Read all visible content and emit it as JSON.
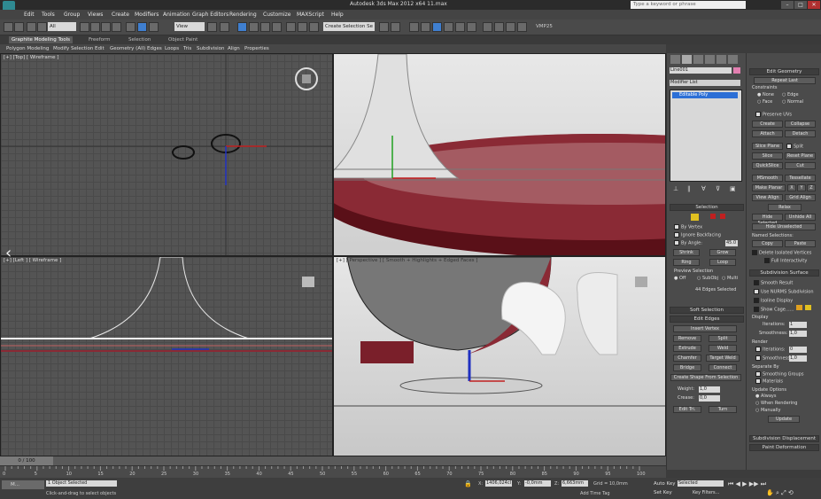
{
  "titlebar": {
    "title": "Autodesk 3ds Max  2012 x64      11.max",
    "search_placeholder": "Type a keyword or phrase",
    "minimize": "–",
    "maximize": "□",
    "close": "✕"
  },
  "menu": [
    "Edit",
    "Tools",
    "Group",
    "Views",
    "Create",
    "Modifiers",
    "Animation",
    "Graph Editors",
    "Rendering",
    "Customize",
    "MAXScript",
    "Help"
  ],
  "toolbar": {
    "selection_filter": "All",
    "ref_coord": "View",
    "named_selection": "Create Selection Se",
    "vmp_label": "VMP25"
  },
  "ribbon": {
    "tabs": [
      "Graphite Modeling Tools",
      "Freeform",
      "Selection",
      "Object Paint"
    ],
    "items": [
      "Polygon Modeling",
      "Modify Selection",
      "Edit",
      "Geometry (All)",
      "Edges",
      "Loops",
      "Tris",
      "Subdivision",
      "Align",
      "Properties"
    ]
  },
  "viewports": {
    "top_left_label": "[+] [Top] [ Wireframe ]",
    "bottom_left_label": "[+] [Left ] [ Wireframe ]",
    "bottom_right_label": "[+] [ Perspective ] [ Smooth + Highlights + Edged Faces ]"
  },
  "command_panel": {
    "object_name": "Line001",
    "modifier_list": "Modifier List",
    "stack_item": "Editable Poly",
    "selection_head": "Selection",
    "by_vertex": "By Vertex",
    "ignore_backfacing": "Ignore Backfacing",
    "by_angle": "By Angle:",
    "by_angle_value": "45.0",
    "shrink": "Shrink",
    "grow": "Grow",
    "ring": "Ring",
    "loop": "Loop",
    "preview_selection": "Preview Selection",
    "preview_off": "Off",
    "preview_subobj": "SubObj",
    "preview_multi": "Multi",
    "edges_selected": "44 Edges Selected",
    "soft_selection": "Soft Selection",
    "edit_edges": "Edit Edges",
    "insert_vertex": "Insert Vertex",
    "remove": "Remove",
    "split": "Split",
    "extrude": "Extrude",
    "weld": "Weld",
    "chamfer": "Chamfer",
    "target_weld": "Target Weld",
    "bridge": "Bridge",
    "connect": "Connect",
    "create_shape": "Create Shape From Selection",
    "weight": "Weight:",
    "weight_value": "1,0",
    "crease": "Crease:",
    "crease_value": "0,0",
    "edit_tri": "Edit Tri.",
    "turn": "Turn"
  },
  "edit_geometry": {
    "head": "Edit Geometry",
    "repeat_last": "Repeat Last",
    "constraints": "Constraints",
    "none": "None",
    "edge": "Edge",
    "face": "Face",
    "normal": "Normal",
    "preserve_uvs": "Preserve UVs",
    "create": "Create",
    "collapse": "Collapse",
    "attach": "Attach",
    "detach": "Detach",
    "slice_plane": "Slice Plane",
    "split": "Split",
    "slice": "Slice",
    "reset_plane": "Reset Plane",
    "quickslice": "QuickSlice",
    "cut": "Cut",
    "msmooth": "MSmooth",
    "tessellate": "Tessellate",
    "make_planar": "Make Planar",
    "x": "X",
    "y": "Y",
    "z": "Z",
    "view_align": "View Align",
    "grid_align": "Grid Align",
    "relax": "Relax",
    "hide_selected": "Hide Selected",
    "unhide_all": "Unhide All",
    "hide_unselected": "Hide Unselected",
    "named_selections": "Named Selections:",
    "copy": "Copy",
    "paste": "Paste",
    "delete_isolated": "Delete Isolated Vertices",
    "full_interactivity": "Full Interactivity"
  },
  "subdivision": {
    "head": "Subdivision Surface",
    "smooth_result": "Smooth Result",
    "use_nurms": "Use NURMS Subdivision",
    "isoline": "Isoline Display",
    "show_cage": "Show Cage......",
    "display": "Display",
    "iterations": "Iterations:",
    "iterations_value": "1",
    "smoothness": "Smoothness:",
    "smoothness_value": "1,0",
    "render": "Render",
    "r_iterations_value": "0",
    "r_smoothness_value": "1,0",
    "separate_by": "Separate By",
    "smoothing_groups": "Smoothing Groups",
    "materials": "Materials",
    "update_options": "Update Options",
    "always": "Always",
    "when_rendering": "When Rendering",
    "manually": "Manually",
    "update": "Update",
    "subdivision_displacement": "Subdivision Displacement",
    "paint_deformation": "Paint Deformation"
  },
  "timeline": {
    "frame": "0 / 100",
    "ticks": [
      "0",
      "5",
      "10",
      "15",
      "20",
      "25",
      "30",
      "35",
      "40",
      "45",
      "50",
      "55",
      "60",
      "65",
      "70",
      "75",
      "80",
      "85",
      "90",
      "95",
      "100"
    ]
  },
  "status": {
    "maxscript": "M...",
    "selected": "1 Object Selected",
    "prompt": "Click-and-drag to select objects",
    "x_value": "1406,024cl",
    "y_value": "-0,0mm",
    "z_value": "6,663mm",
    "grid": "Grid = 10,0mm",
    "auto_key": "Auto Key",
    "selected_set": "Selected",
    "set_key": "Set Key",
    "key_filters": "Key Filters...",
    "add_time_tag": "Add Time Tag"
  },
  "colors": {
    "accent_yellow": "#e0c020",
    "stack_blue": "#2c6fd6",
    "red_swatch": "#c02020",
    "tabletop": "#7a1f2a"
  }
}
